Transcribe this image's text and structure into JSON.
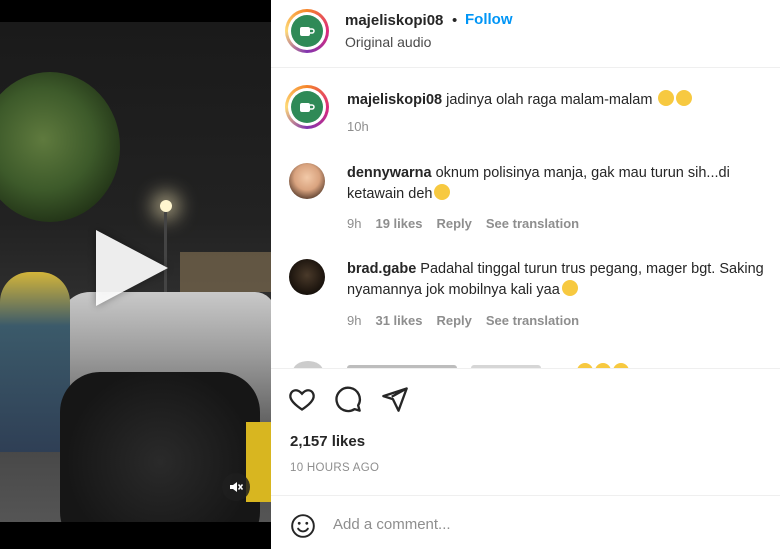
{
  "video": {
    "play_icon": "play-icon",
    "mute_icon": "speaker-muted-icon"
  },
  "post": {
    "username": "majeliskopi08",
    "separator": "•",
    "follow_label": "Follow",
    "audio_label": "Original audio"
  },
  "caption": {
    "username": "majeliskopi08",
    "text": "jadinya olah raga malam-malam",
    "time": "10h"
  },
  "comments": [
    {
      "username": "dennywarna",
      "text": "oknum polisinya manja, gak mau turun sih...di ketawain deh",
      "time": "9h",
      "likes": "19 likes",
      "reply": "Reply",
      "translate": "See translation"
    },
    {
      "username": "brad.gabe",
      "text": "Padahal tinggal turun trus pegang, mager bgt. Saking nyamannya jok mobilnya kali yaa",
      "time": "9h",
      "likes": "31 likes",
      "reply": "Reply",
      "translate": "See translation"
    }
  ],
  "actions": {
    "like_icon": "heart-icon",
    "comment_icon": "comment-icon",
    "share_icon": "paper-plane-icon",
    "likes_count": "2,157 likes",
    "time_ago": "10 HOURS AGO"
  },
  "add_comment": {
    "emoji_icon": "smiley-icon",
    "placeholder": "Add a comment..."
  },
  "colors": {
    "link_blue": "#0095f6",
    "muted_text": "#8e8e8e",
    "primary_text": "#262626",
    "brand_green": "#2f8a57"
  }
}
